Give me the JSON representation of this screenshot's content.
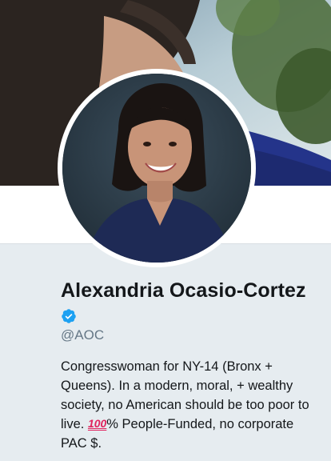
{
  "profile": {
    "name": "Alexandria Ocasio-Cortez",
    "handle": "@AOC",
    "bio": {
      "line1": "Congresswoman for NY-14 (Bronx + Queens). In a modern, moral, + wealthy society, no American should be too poor to live. ",
      "emoji_text": "100",
      "line2": "% People-Funded, no corporate PAC $."
    }
  },
  "icons": {
    "verified": "verified-badge-icon",
    "emoji": "hundred-points-emoji-icon"
  },
  "colors": {
    "background": "#e6ecf0",
    "verified": "#1da1f2",
    "handle": "#657786",
    "name": "#14171a"
  }
}
